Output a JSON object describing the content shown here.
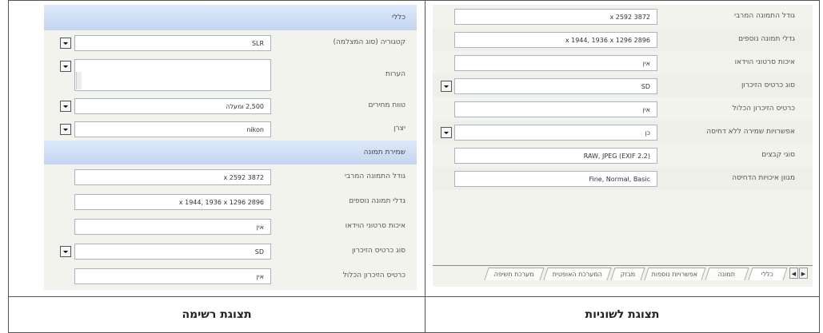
{
  "list_view": {
    "caption": "תצוגת רשימה",
    "general_section": "כללי",
    "general_rows": [
      {
        "label": "קטגוריה (סוג המצלמה)",
        "value": "SLR",
        "dropdown": true
      },
      {
        "label": "הערות",
        "value": "",
        "dropdown": true,
        "multiline": true
      },
      {
        "label": "טווח מחירים",
        "value": "2,500 ומעלה",
        "dropdown": true
      },
      {
        "label": "יצרן",
        "value": "nikon",
        "dropdown": true
      }
    ],
    "image_section": "שמירת תמונה",
    "image_rows": [
      {
        "label": "גודל התמונה המרבי",
        "value": "x 2592 3872",
        "dropdown": false
      },
      {
        "label": "גדלי תמונה נוספים",
        "value": "x 1944, 1936 x 1296 2896",
        "dropdown": false
      },
      {
        "label": "איכות סרטוני הוידאו",
        "value": "אין",
        "dropdown": false
      },
      {
        "label": "סוג כרטיס הזיכרון",
        "value": "SD",
        "dropdown": true
      },
      {
        "label": "כרטיס הזיכרון הכלול",
        "value": "אין",
        "dropdown": false
      }
    ]
  },
  "tab_view": {
    "caption": "תצוגת לשוניות",
    "rows": [
      {
        "label": "גודל התמונה המרבי",
        "value": "x 2592 3872",
        "dropdown": false
      },
      {
        "label": "גדלי תמונה נוספים",
        "value": "x 1944, 1936 x 1296 2896",
        "dropdown": false
      },
      {
        "label": "איכות סרטוני הוידאו",
        "value": "אין",
        "dropdown": false
      },
      {
        "label": "סוג כרטיס הזיכרון",
        "value": "SD",
        "dropdown": true
      },
      {
        "label": "כרטיס הזיכרון הכלול",
        "value": "אין",
        "dropdown": false
      },
      {
        "label": "אפשרויות שמירה ללא דחיסה",
        "value": "כן",
        "dropdown": true
      },
      {
        "label": "סוגי קבצים",
        "value": "(RAW, JPEG (EXIF 2.2",
        "dropdown": false
      },
      {
        "label": "מגוון איכויות הדחיסה",
        "value": "Fine, Normal, Basic",
        "dropdown": false
      }
    ],
    "tabs": [
      "כללי",
      "תמונה",
      "אפשרויות נוספות",
      "מבזק",
      "המערכת האופטית",
      "מערכת חשיפה"
    ],
    "nav_arrows": [
      "◀",
      "▶"
    ]
  }
}
